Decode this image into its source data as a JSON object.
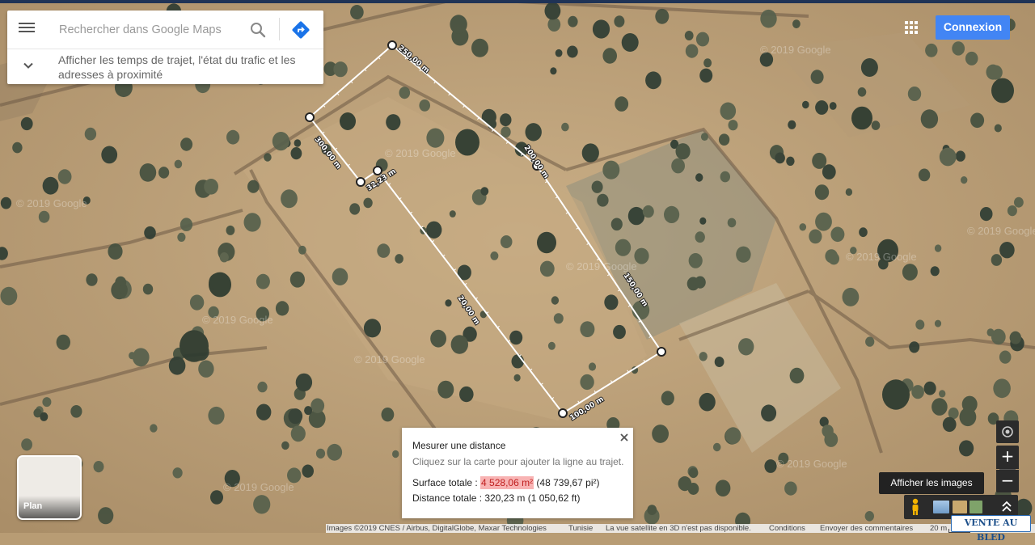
{
  "search": {
    "placeholder": "Rechercher dans Google Maps",
    "expand_text": "Afficher les temps de trajet, l'état du trafic et les adresses à proximité"
  },
  "header": {
    "login_label": "Connexion"
  },
  "map": {
    "layer": "satellite",
    "watermark_text": "© 2019 Google",
    "segment_labels": [
      "250,00 m",
      "200,00 m",
      "300,00 m",
      "32,23 m",
      "20,00 m",
      "150,00 m",
      "100,00 m"
    ]
  },
  "measure_panel": {
    "title": "Mesurer une distance",
    "subtitle": "Cliquez sur la carte pour ajouter la ligne au trajet.",
    "area_label": "Surface totale : ",
    "area_value": "4 528,06 m²",
    "area_alt": " (48 739,67 pi²)",
    "distance_text": "Distance totale : 320,23 m (1 050,62 ft)"
  },
  "layer_switch": {
    "label": "Plan"
  },
  "controls": {
    "tooltip": "Afficher les images",
    "zoom_in": "+",
    "zoom_out": "−"
  },
  "footer": {
    "imagery": "Images ©2019 CNES / Airbus, DigitalGlobe, Maxar Technologies",
    "country": "Tunisie",
    "note_3d": "La vue satellite en 3D n'est pas disponible.",
    "terms": "Conditions",
    "feedback": "Envoyer des commentaires",
    "scale": "20 m"
  },
  "badge": {
    "text": "VENTE AU BLED"
  },
  "colors": {
    "accent": "#4285f4",
    "highlight": "#f8b3b3",
    "terrain": "#b89c74"
  }
}
